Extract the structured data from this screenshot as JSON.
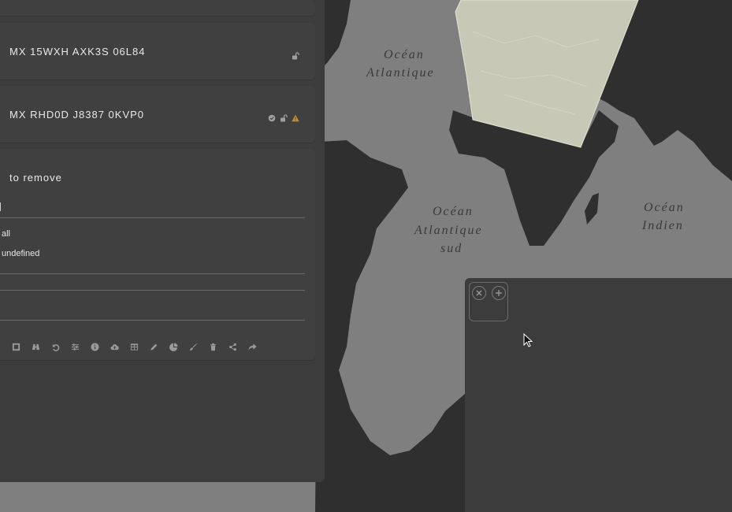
{
  "map": {
    "labels": {
      "atlantic_line1": "Océan",
      "atlantic_line2": "Atlantique",
      "south_line1": "Océan",
      "south_line2": "Atlantique",
      "south_line3": "sud",
      "indian_line1": "Océan",
      "indian_line2": "Indien"
    },
    "colors": {
      "ocean": "#7f7f7f",
      "land": "#2f2f2f",
      "highlight": "#c7c8b5"
    }
  },
  "panel": {
    "cards": [
      {
        "title": "MX 15WXH AXK3S 06L84",
        "icons": [
          "lock-open-icon"
        ]
      },
      {
        "title": "MX RHD0D J8387 0KVP0",
        "icons": [
          "shield-check-icon",
          "lock-open-icon",
          "warning-icon"
        ]
      }
    ],
    "remove": {
      "title": "to remove",
      "options": [
        "all",
        "undefined"
      ]
    },
    "toolbar": [
      "frame-icon",
      "binoculars-icon",
      "undo-icon",
      "sliders-icon",
      "info-icon",
      "cloud-upload-icon",
      "table-icon",
      "pencil-icon",
      "pie-chart-icon",
      "brush-icon",
      "trash-icon",
      "share-icon",
      "forward-icon"
    ],
    "warning_color": "#c8902e"
  },
  "float_panel": {
    "buttons": [
      "close-icon",
      "move-icon"
    ]
  }
}
